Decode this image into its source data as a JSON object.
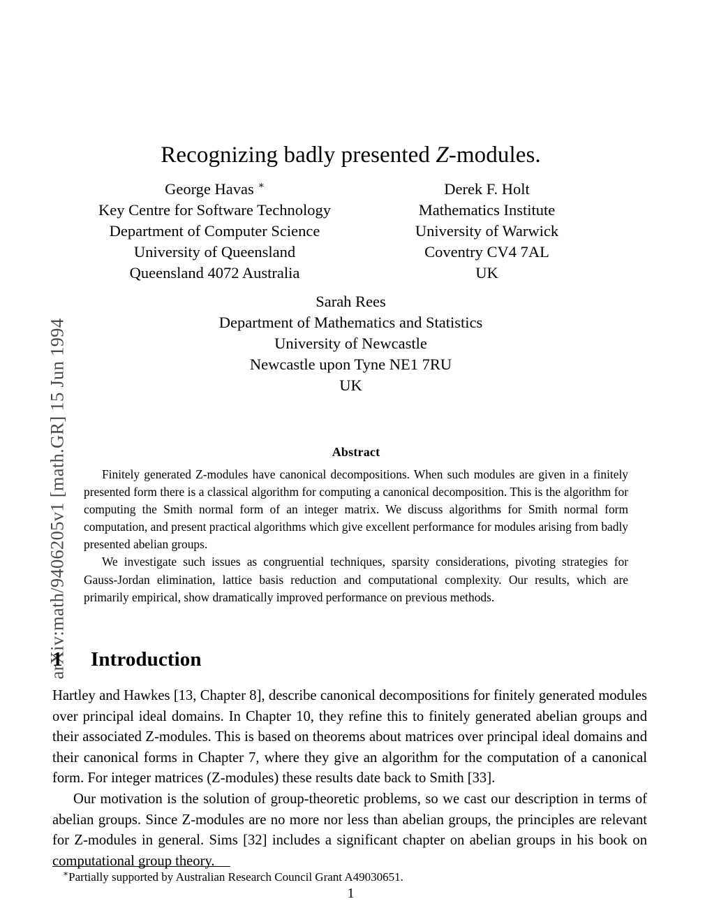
{
  "arxiv": {
    "stamp": "arXiv:math/9406205v1  [math.GR]  15 Jun 1994"
  },
  "title": {
    "before": "Recognizing badly presented ",
    "mathvar": "Z",
    "after": "-modules."
  },
  "authors": {
    "left": {
      "name": "George Havas",
      "footnote_marker": "∗",
      "lines": [
        "Key Centre for Software Technology",
        "Department of Computer Science",
        "University of Queensland",
        "Queensland 4072 Australia"
      ]
    },
    "right": {
      "name": "Derek F. Holt",
      "lines": [
        "Mathematics Institute",
        "University of Warwick",
        "Coventry CV4 7AL",
        "UK"
      ]
    },
    "center": {
      "name": "Sarah Rees",
      "lines": [
        "Department of Mathematics and Statistics",
        "University of Newcastle",
        "Newcastle upon Tyne NE1 7RU",
        "UK"
      ]
    }
  },
  "abstract": {
    "heading": "Abstract",
    "paragraphs": [
      "Finitely generated Z-modules have canonical decompositions. When such modules are given in a finitely presented form there is a classical algorithm for computing a canonical decomposition. This is the algorithm for computing the Smith normal form of an integer matrix. We discuss algorithms for Smith normal form computation, and present practical algorithms which give excellent performance for modules arising from badly presented abelian groups.",
      "We investigate such issues as congruential techniques, sparsity considerations, pivoting strategies for Gauss-Jordan elimination, lattice basis reduction and computational complexity. Our results, which are primarily empirical, show dramatically improved performance on previous methods."
    ]
  },
  "section": {
    "number": "1",
    "title": "Introduction"
  },
  "body": {
    "paragraphs": [
      "Hartley and Hawkes [13, Chapter 8], describe canonical decompositions for finitely generated modules over principal ideal domains. In Chapter 10, they refine this to finitely generated abelian groups and their associated Z-modules. This is based on theorems about matrices over principal ideal domains and their canonical forms in Chapter 7, where they give an algorithm for the computation of a canonical form. For integer matrices (Z-modules) these results date back to Smith [33].",
      "Our motivation is the solution of group-theoretic problems, so we cast our description in terms of abelian groups. Since Z-modules are no more nor less than abelian groups, the principles are relevant for Z-modules in general. Sims [32] includes a significant chapter on abelian groups in his book on computational group theory."
    ]
  },
  "footnote": {
    "marker": "∗",
    "text": "Partially supported by Australian Research Council Grant A49030651."
  },
  "page_number": "1"
}
